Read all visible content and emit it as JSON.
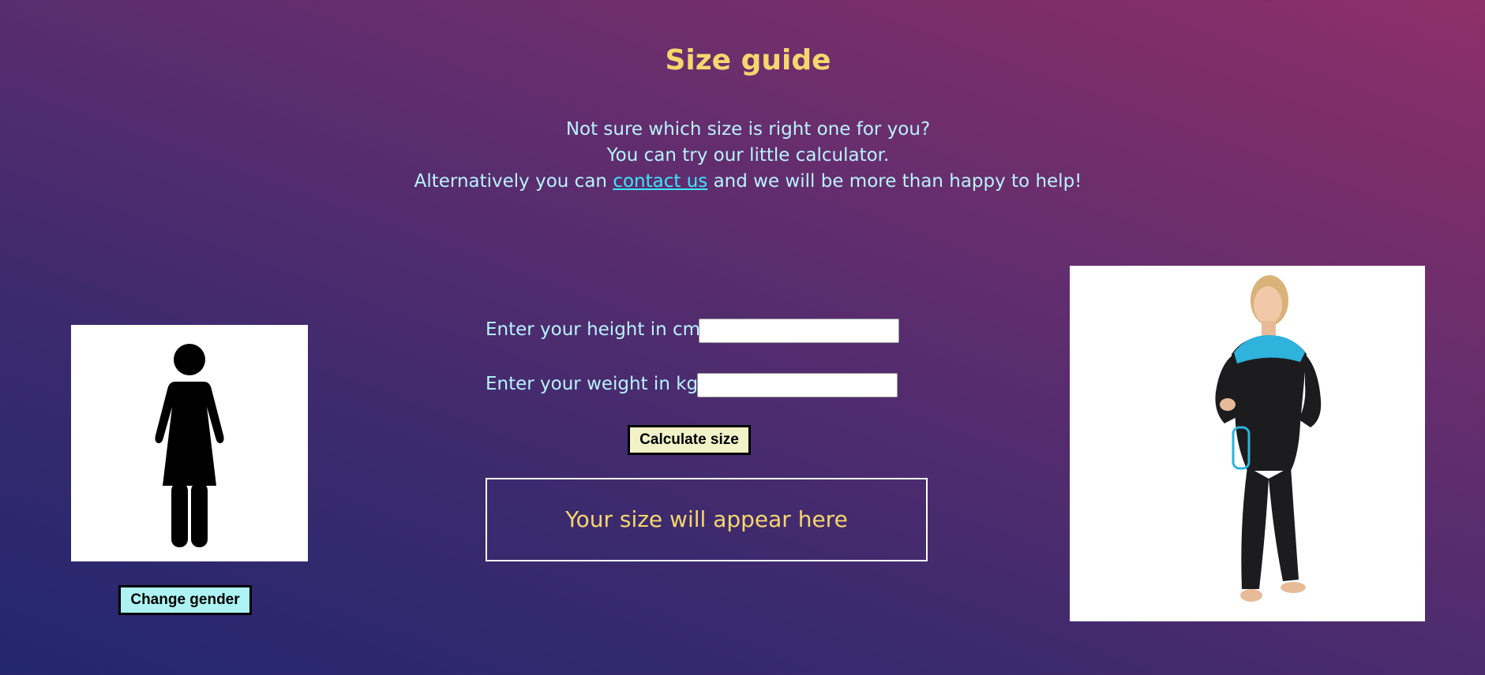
{
  "page": {
    "title": "Size guide"
  },
  "intro": {
    "line1": "Not sure which size is right one for you?",
    "line2": "You can try our little calculator.",
    "line3_before": "Alternatively you can ",
    "link_text": "contact us",
    "line3_after": " and we will be more than happy to help!"
  },
  "gender": {
    "icon": "female-figure-icon",
    "button_label": "Change gender"
  },
  "form": {
    "height_label": "Enter your height in cm",
    "height_value": "",
    "weight_label": "Enter your weight in kg",
    "weight_value": "",
    "calculate_label": "Calculate size"
  },
  "result": {
    "placeholder_text": "Your size will appear here"
  },
  "product_image": {
    "icon": "wetsuit-model-photo"
  },
  "colors": {
    "title": "#f5d76e",
    "text": "#b9f3ff",
    "link": "#3ee6ff",
    "gender_button": "#aef3f3",
    "calculate_button": "#f2f2c8"
  }
}
